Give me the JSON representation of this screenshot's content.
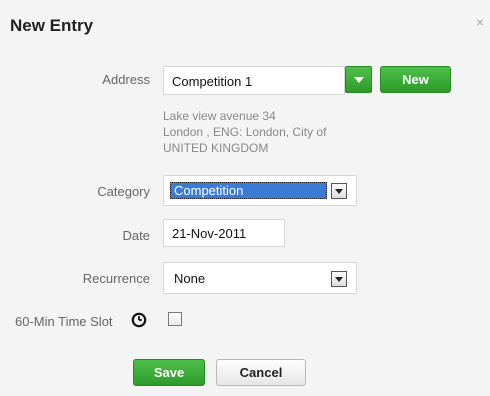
{
  "dialog": {
    "title": "New Entry",
    "close_label": "×"
  },
  "address": {
    "label": "Address",
    "value": "Competition 1",
    "new_button": "New",
    "lines": [
      "Lake view avenue 34",
      "London , ENG: London, City of",
      "UNITED KINGDOM"
    ]
  },
  "category": {
    "label": "Category",
    "value": "Competition"
  },
  "date": {
    "label": "Date",
    "value": "21-Nov-2011"
  },
  "recurrence": {
    "label": "Recurrence",
    "value": "None"
  },
  "time_slot": {
    "label": "60-Min Time Slot",
    "checked": false
  },
  "actions": {
    "save": "Save",
    "cancel": "Cancel"
  },
  "colors": {
    "accent_green": "#3aae35",
    "selection_blue": "#3a7bd5"
  }
}
